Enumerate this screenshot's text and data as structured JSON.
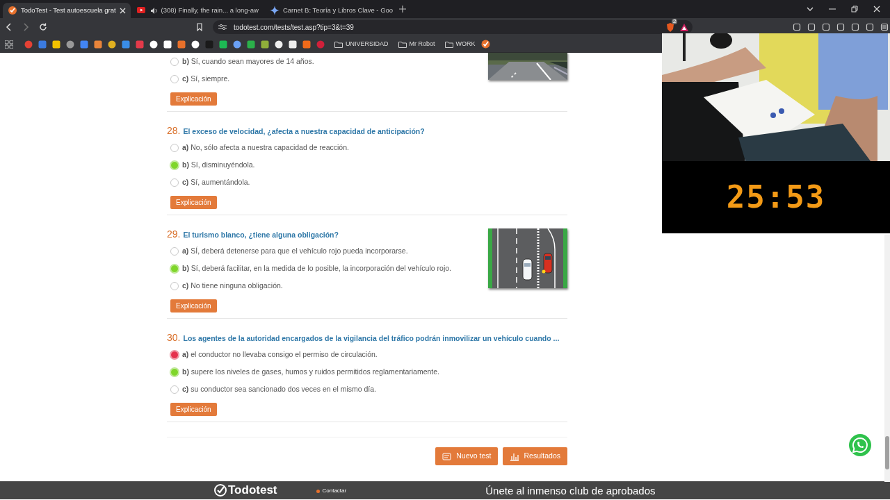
{
  "browser": {
    "tabs": [
      {
        "title": "TodoTest - Test autoescuela grat",
        "selected": true
      },
      {
        "title": "(308) Finally, the rain... a long-aw",
        "selected": false
      },
      {
        "title": "Carnet B: Teoría y Libros Clave - Goo",
        "selected": false
      }
    ],
    "url": "todotest.com/tests/test.asp?tip=3&t=39",
    "extension_badge": "2",
    "bookmark_folders": [
      "UNIVERSIDAD",
      "Mr Robot",
      "WORK"
    ]
  },
  "questions": [
    {
      "options": [
        {
          "letter": "b)",
          "text": "Sí, cuando sean mayores de 14 años.",
          "correct": false,
          "wrong": false
        },
        {
          "letter": "c)",
          "text": "Sí, siempre.",
          "correct": false,
          "wrong": false
        }
      ],
      "button": "Explicación",
      "figure": {
        "kind": "picture"
      }
    },
    {
      "number": "28.",
      "title": "El exceso de velocidad, ¿afecta a nuestra capacidad de anticipación?",
      "options": [
        {
          "letter": "a)",
          "text": "No, sólo afecta a nuestra capacidad de reacción.",
          "correct": false,
          "wrong": false
        },
        {
          "letter": "b)",
          "text": "Sí, disminuyéndola.",
          "correct": true,
          "wrong": false
        },
        {
          "letter": "c)",
          "text": "Sí, aumentándola.",
          "correct": false,
          "wrong": false
        }
      ],
      "button": "Explicación"
    },
    {
      "number": "29.",
      "title": "El turismo blanco, ¿tiene alguna obligación?",
      "options": [
        {
          "letter": "a)",
          "text": "SÍ, deberá detenerse para que el vehículo rojo pueda incorporarse.",
          "correct": false,
          "wrong": false
        },
        {
          "letter": "b)",
          "text": "Sí, deberá facilitar, en la medida de lo posible, la incorporación del vehículo rojo.",
          "correct": true,
          "wrong": false
        },
        {
          "letter": "c)",
          "text": "No tiene ninguna obligación.",
          "correct": false,
          "wrong": false
        }
      ],
      "button": "Explicación",
      "figure": {
        "kind": "diagram"
      }
    },
    {
      "number": "30.",
      "title": "Los agentes de la autoridad encargados de la vigilancia del tráfico podrán inmovilizar un vehículo cuando ...",
      "options": [
        {
          "letter": "a)",
          "text": "el conductor no llevaba consigo el permiso de circulación.",
          "correct": false,
          "wrong": true
        },
        {
          "letter": "b)",
          "text": "supere los niveles de gases, humos y ruidos permitidos reglamentariamente.",
          "correct": true,
          "wrong": false
        },
        {
          "letter": "c)",
          "text": "su conductor sea sancionado dos veces en el mismo día.",
          "correct": false,
          "wrong": false
        }
      ],
      "button": "Explicación"
    }
  ],
  "actions": [
    {
      "label": "Nuevo test",
      "kind": "new"
    },
    {
      "label": "Resultados",
      "kind": "results"
    }
  ],
  "footer": {
    "logo": "Todotest",
    "link": "Contactar",
    "heading": "Únete al inmenso club de aprobados"
  },
  "webcam": {
    "kind": "picture",
    "timer": "25:53"
  }
}
